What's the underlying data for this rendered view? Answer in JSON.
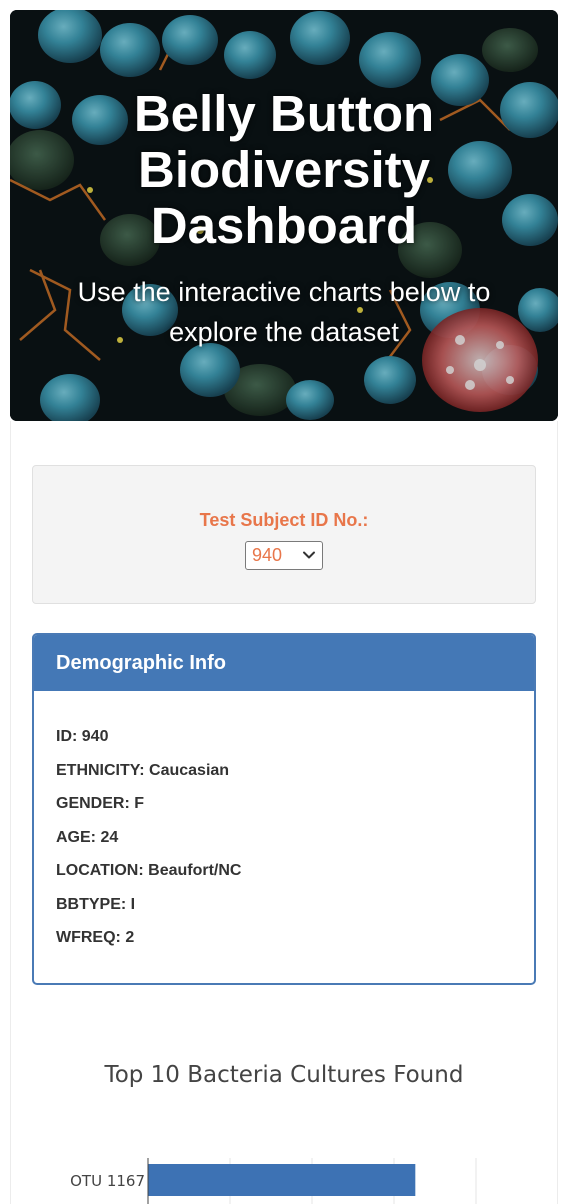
{
  "header": {
    "title": "Belly Button Biodiversity Dashboard",
    "subtitle": "Use the interactive charts below to explore the dataset"
  },
  "selector": {
    "label": "Test Subject ID No.:",
    "selected_value": "940"
  },
  "demographics": {
    "heading": "Demographic Info",
    "rows": [
      "ID: 940",
      "ETHNICITY: Caucasian",
      "GENDER: F",
      "AGE: 24",
      "LOCATION: Beaufort/NC",
      "BBTYPE: I",
      "WFREQ: 2"
    ]
  },
  "colors": {
    "accent": "#e8764a",
    "panel_blue": "#4478b6",
    "bar_blue": "#3d72b4"
  },
  "chart_data": {
    "type": "bar",
    "orientation": "horizontal",
    "title": "Top 10 Bacteria Cultures Found",
    "categories": [
      "OTU 1167"
    ],
    "values": [
      163
    ],
    "xlim": [
      0,
      250
    ],
    "grid": true
  }
}
